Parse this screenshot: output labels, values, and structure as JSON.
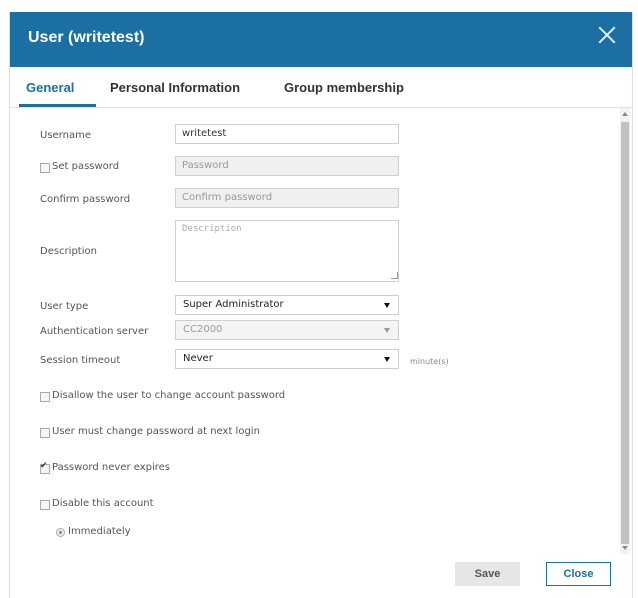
{
  "dialog": {
    "title": "User (writetest)"
  },
  "tabs": [
    {
      "label": "General",
      "active": true
    },
    {
      "label": "Personal Information"
    },
    {
      "label": "Group membership"
    }
  ],
  "form": {
    "username": {
      "label": "Username",
      "value": "writetest"
    },
    "set_password": {
      "label": "Set password",
      "placeholder": "Password",
      "checked": false
    },
    "confirm_password": {
      "label": "Confirm password",
      "placeholder": "Confirm password"
    },
    "description": {
      "label": "Description",
      "placeholder": "Description"
    },
    "user_type": {
      "label": "User type",
      "value": "Super Administrator"
    },
    "auth_server": {
      "label": "Authentication server",
      "value": "CC2000"
    },
    "session_timeout": {
      "label": "Session timeout",
      "value": "Never",
      "unit": "minute(s)"
    },
    "disallow_change": {
      "label": "Disallow the user to change account password",
      "checked": false
    },
    "must_change": {
      "label": "User must change password at next login",
      "checked": false
    },
    "never_expires": {
      "label": "Password never expires",
      "checked": true
    },
    "disable_account": {
      "label": "Disable this account",
      "checked": false
    },
    "immediately": {
      "label": "Immediately"
    }
  },
  "buttons": {
    "save": "Save",
    "close": "Close"
  },
  "colors": {
    "accent": "#1b6fa2"
  }
}
